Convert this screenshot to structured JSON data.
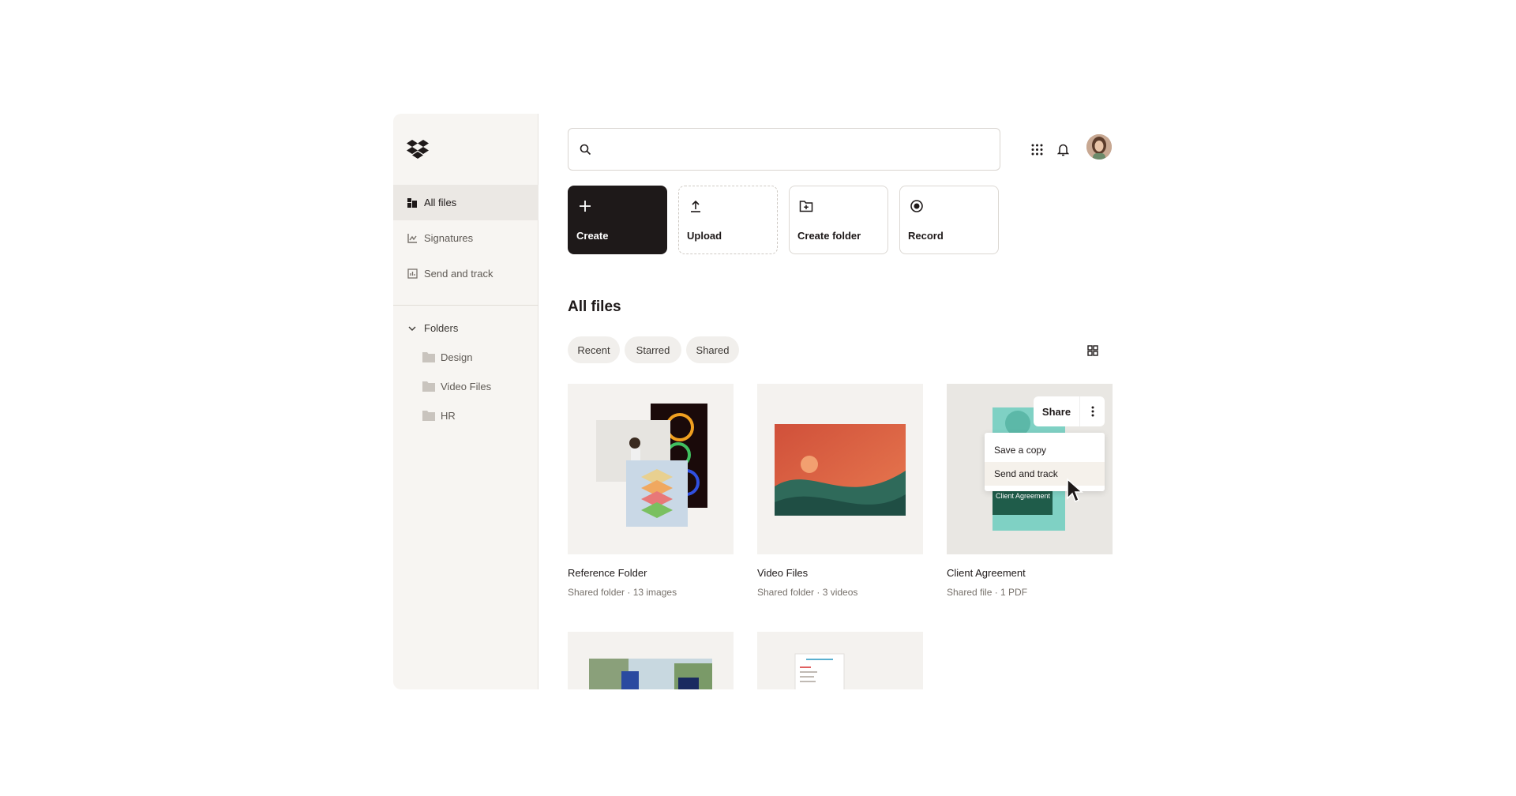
{
  "sidebar": {
    "nav": [
      {
        "label": "All files",
        "icon": "all-files-icon"
      },
      {
        "label": "Signatures",
        "icon": "signature-icon"
      },
      {
        "label": "Send and track",
        "icon": "send-track-icon"
      }
    ],
    "folders_label": "Folders",
    "folders": [
      {
        "label": "Design"
      },
      {
        "label": "Video Files"
      },
      {
        "label": "HR"
      }
    ]
  },
  "search": {
    "placeholder": ""
  },
  "actions": [
    {
      "label": "Create",
      "icon": "plus-icon"
    },
    {
      "label": "Upload",
      "icon": "upload-icon"
    },
    {
      "label": "Create folder",
      "icon": "folder-plus-icon"
    },
    {
      "label": "Record",
      "icon": "record-icon"
    }
  ],
  "section_title": "All files",
  "filters": [
    "Recent",
    "Starred",
    "Shared"
  ],
  "files": [
    {
      "name": "Reference Folder",
      "meta": "Shared folder · 13 images"
    },
    {
      "name": "Video Files",
      "meta": "Shared folder · 3 videos"
    },
    {
      "name": "Client Agreement",
      "meta": "Shared file · 1 PDF",
      "thumb_text": "Client Agreement"
    }
  ],
  "context": {
    "share_label": "Share",
    "menu": [
      "Save a copy",
      "Send and track"
    ]
  },
  "colors": {
    "accent_dark": "#1e1919",
    "sidebar_bg": "#f7f5f2",
    "teal": "#7fd1c4",
    "dark_green": "#1f5c4a"
  }
}
